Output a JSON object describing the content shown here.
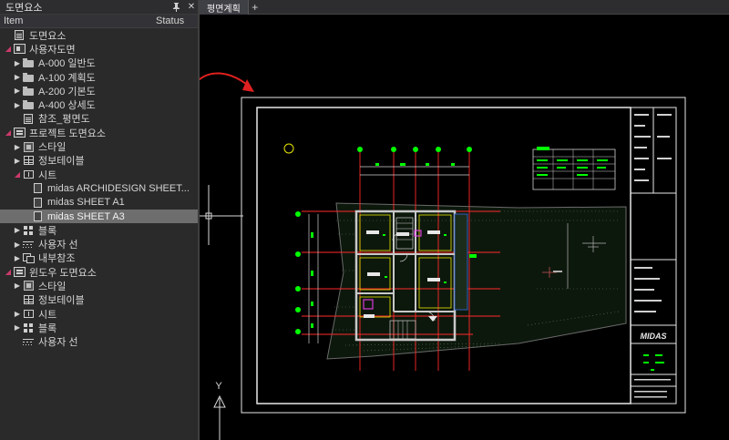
{
  "panel": {
    "title": "도면요소",
    "pin_glyph": "📌",
    "close_glyph": "✕",
    "columns": {
      "item": "Item",
      "status": "Status"
    },
    "tree": [
      {
        "label": "도면요소",
        "indent": 0,
        "twisty": "",
        "icon": "drawing-elements-icon",
        "icls": "i-doc"
      },
      {
        "label": "사용자도면",
        "indent": 0,
        "twisty": "open",
        "icon": "user-drawing-icon",
        "icls": "i-user"
      },
      {
        "label": "A-000 일반도",
        "indent": 1,
        "twisty": "closed",
        "icon": "folder-icon",
        "icls": "i-folder"
      },
      {
        "label": "A-100 계획도",
        "indent": 1,
        "twisty": "closed",
        "icon": "folder-icon",
        "icls": "i-folder"
      },
      {
        "label": "A-200 기본도",
        "indent": 1,
        "twisty": "closed",
        "icon": "folder-icon",
        "icls": "i-folder"
      },
      {
        "label": "A-400 상세도",
        "indent": 1,
        "twisty": "closed",
        "icon": "folder-icon",
        "icls": "i-folder"
      },
      {
        "label": "참조_평면도",
        "indent": 1,
        "twisty": "",
        "icon": "reference-drawing-icon",
        "icls": "i-doc"
      },
      {
        "label": "프로젝트 도면요소",
        "indent": 0,
        "twisty": "open",
        "icon": "project-icon",
        "icls": "i-project"
      },
      {
        "label": "스타일",
        "indent": 1,
        "twisty": "closed",
        "icon": "style-icon",
        "icls": "i-style"
      },
      {
        "label": "정보테이블",
        "indent": 1,
        "twisty": "closed",
        "icon": "table-icon",
        "icls": "i-table"
      },
      {
        "label": "시트",
        "indent": 1,
        "twisty": "open",
        "icon": "sheet-icon",
        "icls": "i-sheet"
      },
      {
        "label": "midas ARCHIDESIGN SHEET...",
        "indent": 2,
        "twisty": "",
        "icon": "sheet-file-icon",
        "icls": "i-sheetfile"
      },
      {
        "label": "midas SHEET A1",
        "indent": 2,
        "twisty": "",
        "icon": "sheet-file-icon",
        "icls": "i-sheetfile"
      },
      {
        "label": "midas SHEET A3",
        "indent": 2,
        "twisty": "",
        "icon": "sheet-file-icon",
        "icls": "i-sheetfile",
        "selected": true
      },
      {
        "label": "블록",
        "indent": 1,
        "twisty": "closed",
        "icon": "block-icon",
        "icls": "i-block"
      },
      {
        "label": "사용자 선",
        "indent": 1,
        "twisty": "closed",
        "icon": "linetype-icon",
        "icls": "i-line"
      },
      {
        "label": "내부참조",
        "indent": 1,
        "twisty": "closed",
        "icon": "xref-icon",
        "icls": "i-xref"
      },
      {
        "label": "윈도우 도면요소",
        "indent": 0,
        "twisty": "open",
        "icon": "window-elements-icon",
        "icls": "i-project"
      },
      {
        "label": "스타일",
        "indent": 1,
        "twisty": "closed",
        "icon": "style-icon",
        "icls": "i-style"
      },
      {
        "label": "정보테이블",
        "indent": 1,
        "twisty": "",
        "icon": "table-icon",
        "icls": "i-table"
      },
      {
        "label": "시트",
        "indent": 1,
        "twisty": "closed",
        "icon": "sheet-icon",
        "icls": "i-sheet"
      },
      {
        "label": "블록",
        "indent": 1,
        "twisty": "closed",
        "icon": "block-icon",
        "icls": "i-block"
      },
      {
        "label": "사용자 선",
        "indent": 1,
        "twisty": "",
        "icon": "linetype-icon",
        "icls": "i-line"
      }
    ]
  },
  "tabs": [
    {
      "label": "평면계획",
      "active": true
    }
  ],
  "tab_add": "+",
  "canvas": {
    "ucs_axis_label": "Y",
    "logo_text": "MIDAS",
    "colors": {
      "sheet_border": "#e8e8e8",
      "wall": "#c8c8c8",
      "accent_green": "#00ff00",
      "grid_red": "#ff2a2a",
      "room_yellow": "#e6e600",
      "terrain": "#4a5a4a",
      "annotation_arrow": "#e02020"
    }
  }
}
